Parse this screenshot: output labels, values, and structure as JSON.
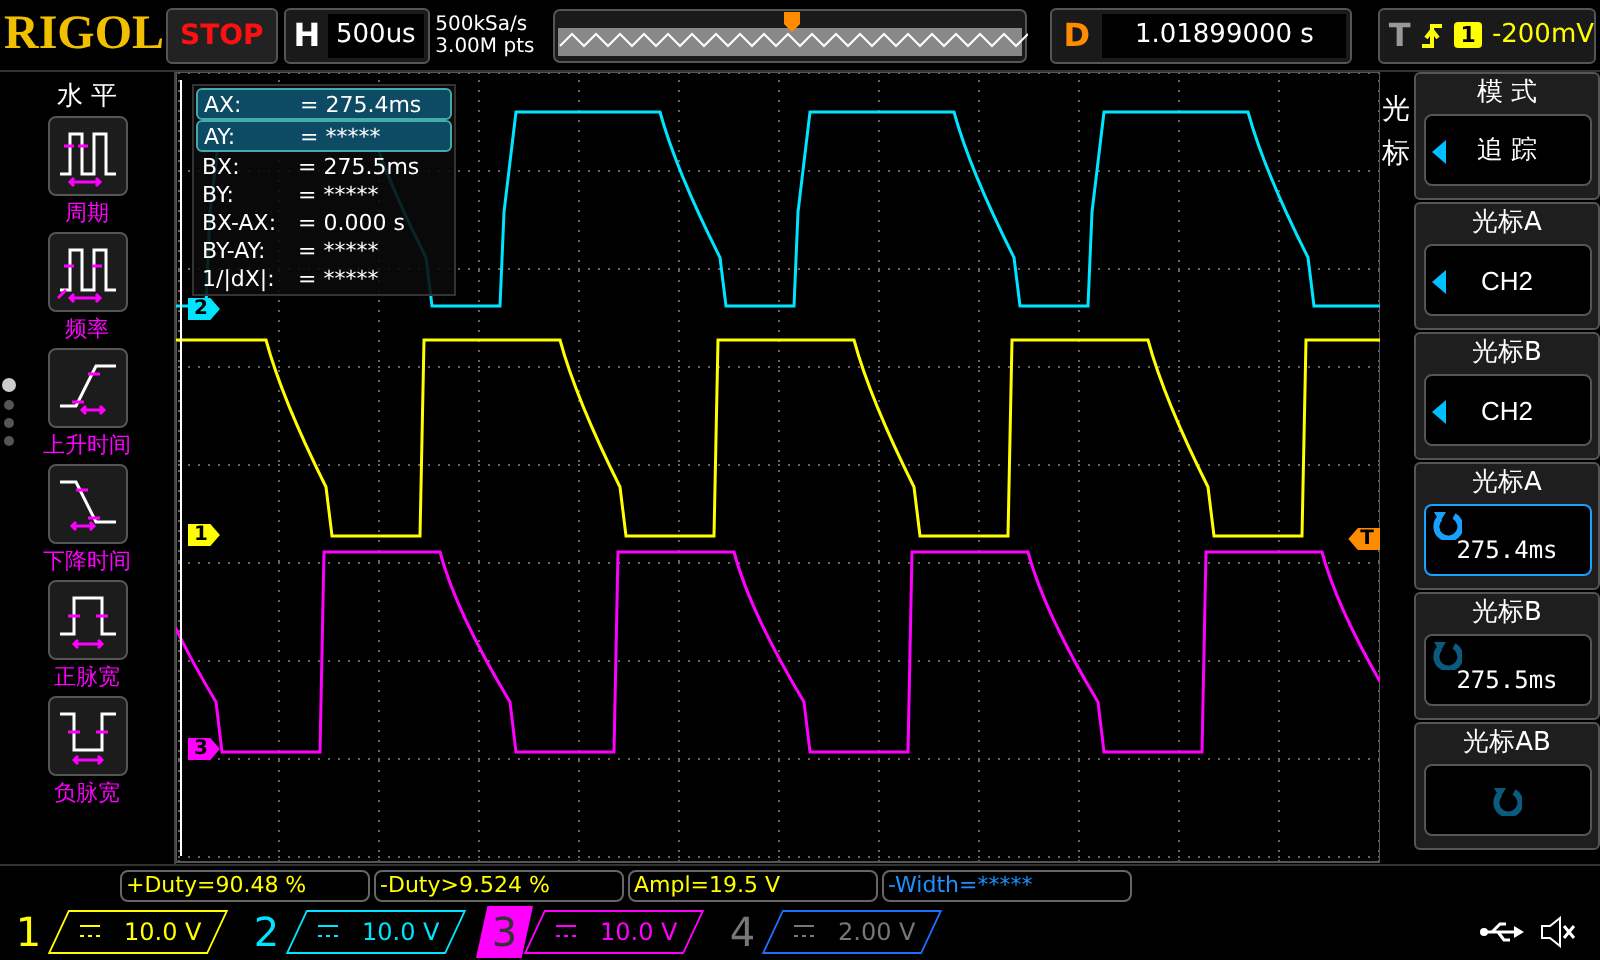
{
  "header": {
    "logo": "RIGOL",
    "run_state": "STOP",
    "timebase": {
      "label": "H",
      "value": "500us"
    },
    "sample_rate": "500kSa/s",
    "memory_depth": "3.00M pts",
    "delay": {
      "label": "D",
      "value": "1.01899000 s"
    },
    "trigger": {
      "label": "T",
      "source": "1",
      "level": "-200mV"
    }
  },
  "sidebar": {
    "title": "水 平",
    "page_dots": [
      {
        "selected": true
      },
      {
        "selected": false
      },
      {
        "selected": false
      },
      {
        "selected": false
      }
    ],
    "items": [
      {
        "kind": "period",
        "label": "周期"
      },
      {
        "kind": "frequency",
        "label": "频率"
      },
      {
        "kind": "rise",
        "label": "上升时间"
      },
      {
        "kind": "fall",
        "label": "下降时间"
      },
      {
        "kind": "pwidth",
        "label": "正脉宽"
      },
      {
        "kind": "nwidth",
        "label": "负脉宽"
      }
    ]
  },
  "scope": {
    "channel_markers": [
      {
        "label": "2",
        "color": "#00e5ff"
      },
      {
        "label": "1",
        "color": "#ffff00"
      },
      {
        "label": "3",
        "color": "#ff00ff"
      }
    ],
    "trigger_marker": "T",
    "cursor_readout": [
      {
        "label": "AX:",
        "value": "= 275.4ms",
        "selected": true
      },
      {
        "label": "AY:",
        "value": "= *****",
        "selected": true
      },
      {
        "label": "BX:",
        "value": "= 275.5ms",
        "selected": false
      },
      {
        "label": "BY:",
        "value": "= *****",
        "selected": false
      },
      {
        "label": "BX-AX:",
        "value": "= 0.000 s",
        "selected": false
      },
      {
        "label": "BY-AY:",
        "value": "= *****",
        "selected": false
      },
      {
        "label": "1/|dX|:",
        "value": "= *****",
        "selected": false
      }
    ]
  },
  "menu": {
    "title": "光标",
    "items": [
      {
        "kind": "select",
        "title": "模 式",
        "value": "追 踪"
      },
      {
        "kind": "select",
        "title": "光标A",
        "value": "CH2"
      },
      {
        "kind": "select",
        "title": "光标B",
        "value": "CH2"
      },
      {
        "kind": "knob",
        "title": "光标A",
        "value": "275.4ms",
        "active": true
      },
      {
        "kind": "knob",
        "title": "光标B",
        "value": "275.5ms",
        "active": false
      },
      {
        "kind": "knob",
        "title": "光标AB",
        "active": false
      }
    ]
  },
  "measurements": [
    {
      "text": "+Duty=90.48 %",
      "color": "#ffff00"
    },
    {
      "text": "-Duty>9.524 %",
      "color": "#ffff00"
    },
    {
      "text": "Ampl=19.5 V",
      "color": "#ffff00"
    },
    {
      "text": "-Width=*****",
      "color": "#1e90ff"
    }
  ],
  "channels": [
    {
      "number": "1",
      "scale": "10.0 V",
      "color": "#ffff00",
      "on": true,
      "selected": false
    },
    {
      "number": "2",
      "scale": "10.0 V",
      "color": "#00e5ff",
      "on": true,
      "selected": false
    },
    {
      "number": "3",
      "scale": "10.0 V",
      "color": "#ff00ff",
      "on": true,
      "selected": true
    },
    {
      "number": "4",
      "scale": "2.00 V",
      "color": "#1e6fff",
      "on": false,
      "selected": false
    }
  ]
}
